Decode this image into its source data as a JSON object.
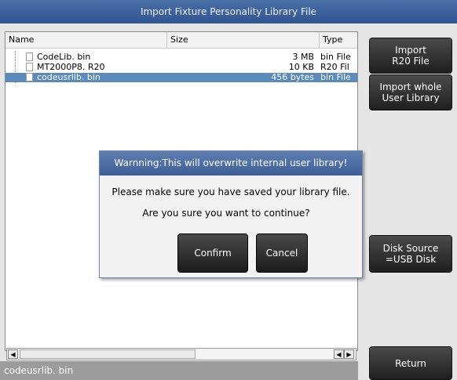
{
  "window": {
    "title": "Import Fixture Personality Library File"
  },
  "table": {
    "columns": [
      "Name",
      "Size",
      "Type"
    ],
    "rows": [
      {
        "name": "CodeLib. bin",
        "size": "3 MB",
        "type": "bin File"
      },
      {
        "name": "MT2000P8. R20",
        "size": "10 KB",
        "type": "R20 Fil"
      },
      {
        "name": "codeusrlib. bin",
        "size": "456 bytes",
        "type": "bin File"
      }
    ]
  },
  "status": {
    "text": "codeusrlib. bin"
  },
  "sidebar": {
    "import_r20": "Import\nR20 File",
    "import_whole": "Import whole\nUser Library",
    "disk_source": "Disk Source\n=USB Disk",
    "return": "Return"
  },
  "dialog": {
    "title": "Warnning:This will overwrite internal user library!",
    "line1": "Please make sure you have saved your library file.",
    "line2": "Are you sure you want to continue?",
    "confirm": "Confirm",
    "cancel": "Cancel"
  },
  "colors": {
    "title_bar": "#3a5f99",
    "selection": "#5b8bbd",
    "button": "#2b2b2b",
    "status_bar": "#9c9c9c"
  }
}
